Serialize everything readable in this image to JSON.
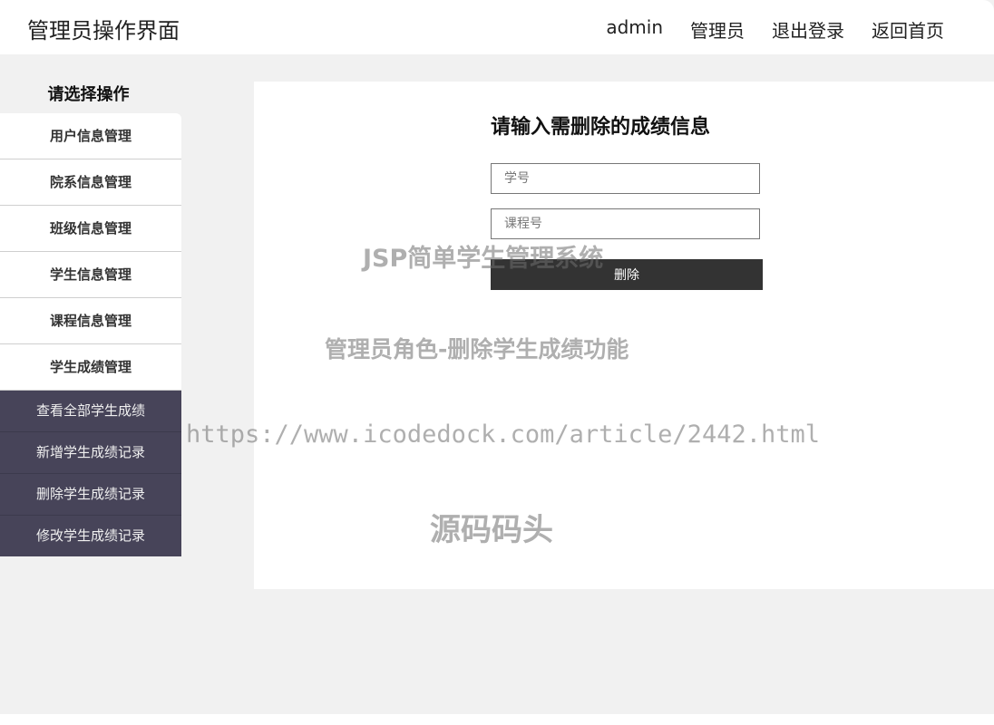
{
  "header": {
    "title": "管理员操作界面",
    "nav": {
      "username": "admin",
      "role": "管理员",
      "logout": "退出登录",
      "home": "返回首页"
    }
  },
  "sidebar": {
    "title": "请选择操作",
    "items": [
      {
        "label": "用户信息管理"
      },
      {
        "label": "院系信息管理"
      },
      {
        "label": "班级信息管理"
      },
      {
        "label": "学生信息管理"
      },
      {
        "label": "课程信息管理"
      },
      {
        "label": "学生成绩管理"
      }
    ],
    "subitems": [
      {
        "label": "查看全部学生成绩"
      },
      {
        "label": "新增学生成绩记录"
      },
      {
        "label": "删除学生成绩记录"
      },
      {
        "label": "修改学生成绩记录"
      }
    ]
  },
  "form": {
    "title": "请输入需删除的成绩信息",
    "student_id": {
      "placeholder": "学号",
      "value": ""
    },
    "course_id": {
      "placeholder": "课程号",
      "value": ""
    },
    "submit_label": "删除"
  },
  "watermarks": {
    "line1": "JSP简单学生管理系统",
    "line2": "管理员角色-删除学生成绩功能",
    "line3": "https://www.icodedock.com/article/2442.html",
    "line4": "源码码头"
  },
  "colors": {
    "submenu_bg": "#474459",
    "button_bg": "#333333",
    "page_bg": "#f1f1f1"
  }
}
